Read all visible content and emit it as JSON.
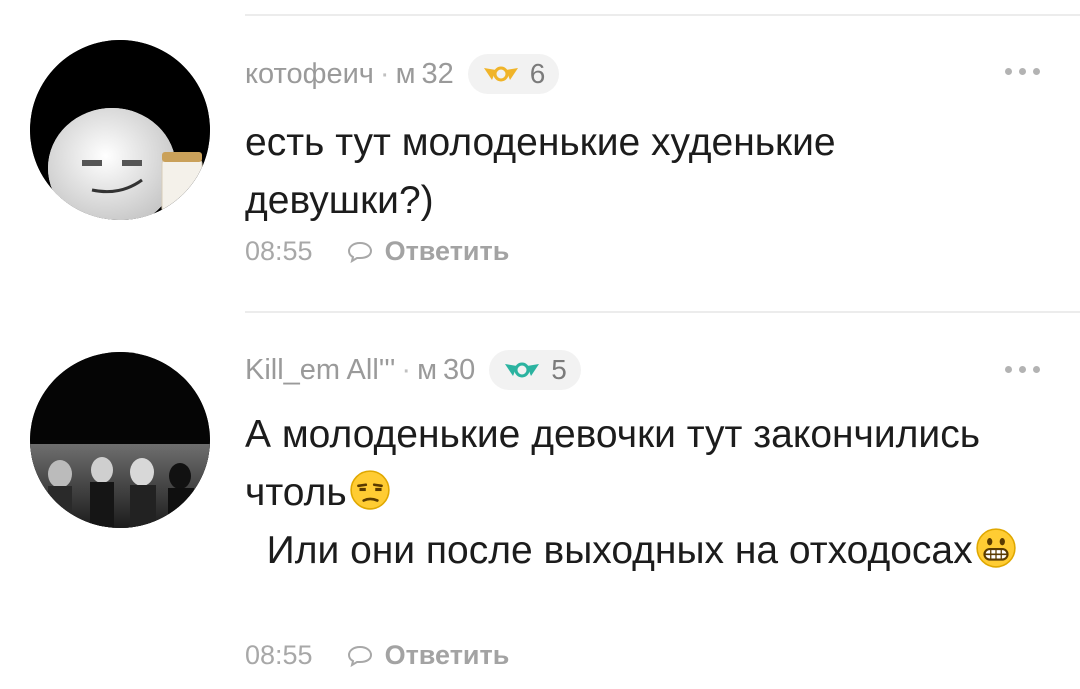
{
  "comments": [
    {
      "username": "котофеич",
      "gender": "м",
      "age": "32",
      "level": "6",
      "text": "есть тут молоденькие худенькие девушки?)",
      "time": "08:55",
      "reply_label": "Ответить"
    },
    {
      "username": "Kill_em All'''",
      "gender": "м",
      "age": "30",
      "level": "5",
      "text_line1": "А молоденькие девочки тут закончились чтоль",
      "emoji1": "unamused-face-emoji",
      "text_line2": "  Или они после выходных на отходосах",
      "emoji2": "grinning-face-emoji",
      "time": "08:55",
      "reply_label": "Ответить"
    }
  ],
  "colors": {
    "level_badge_1": "#f0b429",
    "level_badge_2": "#2bb3a0",
    "meta_text": "#9a9a9a"
  }
}
